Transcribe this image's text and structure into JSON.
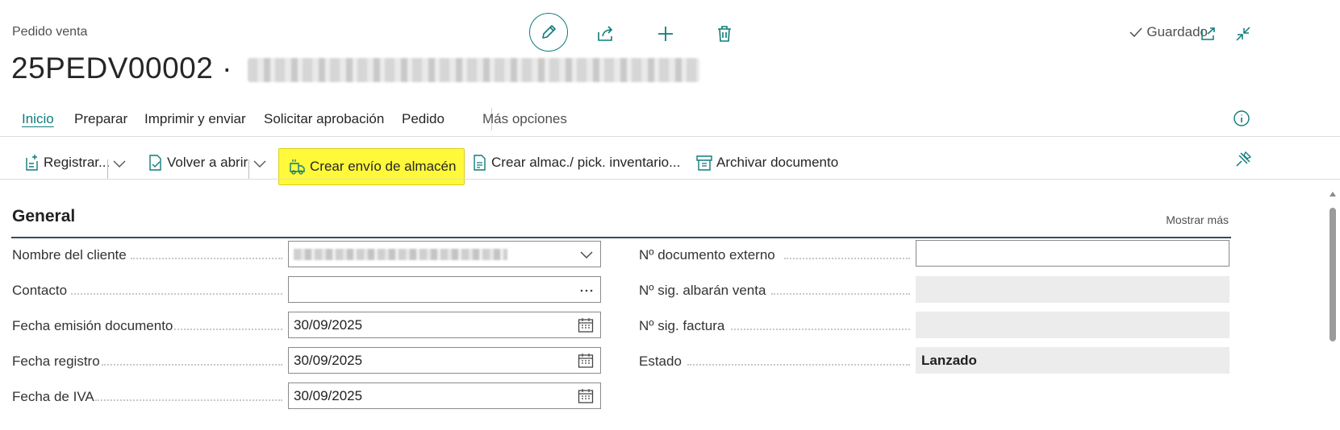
{
  "header": {
    "page_type": "Pedido venta",
    "doc_number": "25PEDV00002",
    "title_separator": " · ",
    "customer_blurred": "[redacted]",
    "saved_label": "Guardado"
  },
  "tabs": [
    {
      "label": "Inicio",
      "active": true
    },
    {
      "label": "Preparar"
    },
    {
      "label": "Imprimir y enviar"
    },
    {
      "label": "Solicitar aprobación"
    },
    {
      "label": "Pedido"
    },
    {
      "label": "Más opciones"
    }
  ],
  "actions": {
    "registrar": "Registrar...",
    "volver_abrir": "Volver a abrir",
    "crear_envio": "Crear envío de almacén",
    "crear_almac": "Crear almac./ pick. inventario...",
    "archivar": "Archivar documento"
  },
  "section": {
    "title": "General",
    "show_more": "Mostrar más"
  },
  "left_fields": [
    {
      "label": "Nombre del cliente",
      "value": "",
      "blurred": true,
      "icon": "chevron-down-icon"
    },
    {
      "label": "Contacto",
      "value": "",
      "icon": "ellipsis-icon"
    },
    {
      "label": "Fecha emisión documento",
      "value": "30/09/2025",
      "icon": "calendar-icon"
    },
    {
      "label": "Fecha registro",
      "value": "30/09/2025",
      "icon": "calendar-icon"
    },
    {
      "label": "Fecha de IVA",
      "value": "30/09/2025",
      "icon": "calendar-icon"
    }
  ],
  "right_fields": [
    {
      "label": "Nº documento externo",
      "value": "",
      "editable": true
    },
    {
      "label": "Nº sig. albarán venta",
      "value": "",
      "editable": false
    },
    {
      "label": "Nº sig. factura",
      "value": "",
      "editable": false
    },
    {
      "label": "Estado",
      "value": "Lanzado",
      "editable": false
    }
  ],
  "colors": {
    "accent": "#0f7b7b",
    "highlight": "#fff93a",
    "section_rule": "#3a4c5c"
  }
}
